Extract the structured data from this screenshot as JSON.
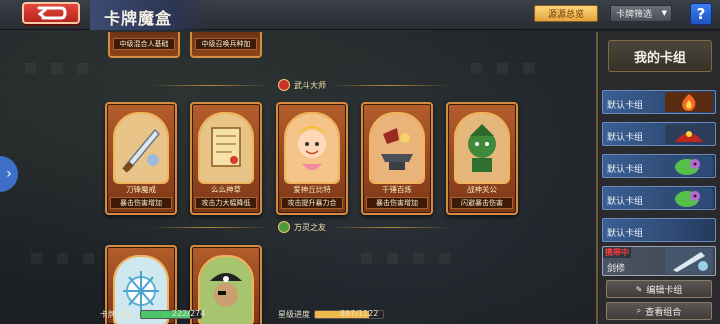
{
  "header": {
    "title": "卡牌魔盒",
    "source_button": "源源总览",
    "filter_button": "卡牌筛选",
    "help": "?"
  },
  "sections": [
    {
      "title": "武斗大师"
    },
    {
      "title": "万灵之友"
    }
  ],
  "top_partial_cards": [
    {
      "desc": "中级混合人基础"
    },
    {
      "desc": "中级召唤兵种加"
    }
  ],
  "cards_row1": [
    {
      "name": "刀锋魔戒",
      "desc": "暴击伤害增加"
    },
    {
      "name": "么么神草",
      "desc": "攻击力大幅降低"
    },
    {
      "name": "爱神丘比特",
      "desc": "攻击提升暴力合"
    },
    {
      "name": "千锤百炼",
      "desc": "暴击伤害增加"
    },
    {
      "name": "战神关公",
      "desc": "闪避暴击伤害"
    }
  ],
  "deck_panel": {
    "title": "我的卡组",
    "decks": [
      {
        "label": "默认卡组",
        "art": "fire-card-art"
      },
      {
        "label": "默认卡组",
        "art": "red-dragon-card-art"
      },
      {
        "label": "默认卡组",
        "art": "green-skull-card-art"
      },
      {
        "label": "默认卡组",
        "art": "green-skull-card-art"
      },
      {
        "label": "默认卡组",
        "art": ""
      }
    ],
    "active": {
      "tag": "携带中",
      "name": "剑修"
    },
    "edit_button": "编辑卡组",
    "view_button": "查看组合"
  },
  "status": {
    "collection_label": "卡牌收藏",
    "collection_value": "222/274",
    "collection_fraction": 0.81,
    "star_label": "星级进度",
    "star_value": "897/1122",
    "star_fraction": 0.8
  },
  "colors": {
    "back_red": "#e2473c",
    "accent_gold": "#ffd67a",
    "help_blue": "#3d7ff0",
    "deck_blue": "#3a5f94",
    "active_tag_red": "#ff3d3d",
    "collection_green": "#4cc46a",
    "star_gold": "#f0b84a"
  }
}
